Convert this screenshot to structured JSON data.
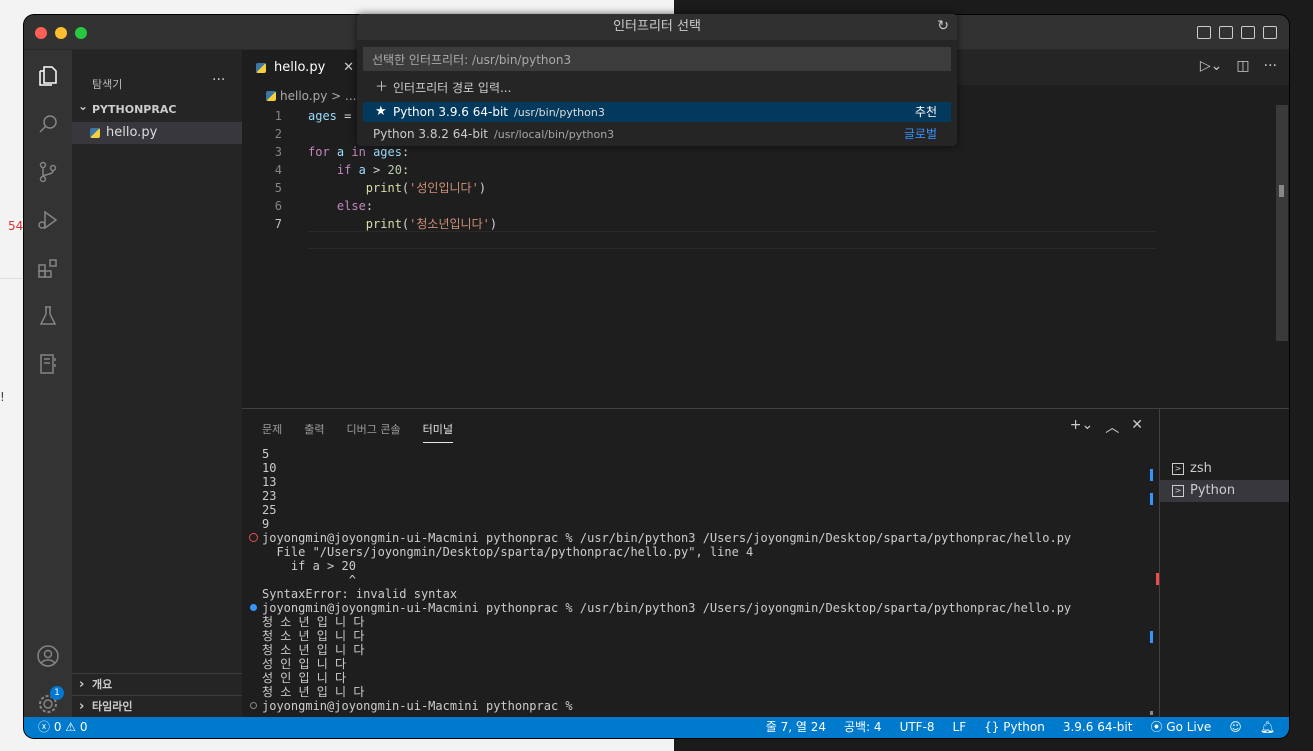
{
  "window": {
    "title": "인터프리터 선택"
  },
  "quick_pick": {
    "title": "인터프리터 선택",
    "input_value": "선택한 인터프리터: /usr/bin/python3",
    "items": [
      {
        "label": "인터프리터 경로 입력...",
        "desc": "",
        "tag": ""
      },
      {
        "label": "Python 3.9.6 64-bit",
        "desc": "/usr/bin/python3",
        "tag": "추천"
      },
      {
        "label": "Python 3.8.2 64-bit",
        "desc": "/usr/local/bin/python3",
        "tag": "글로벌"
      }
    ]
  },
  "sidebar": {
    "title": "탐색기",
    "folder": "PYTHONPRAC",
    "file": "hello.py",
    "sections": [
      "개요",
      "타임라인"
    ]
  },
  "tab": {
    "label": "hello.py"
  },
  "breadcrumb": "hello.py > ...",
  "editor": {
    "lines": [
      {
        "n": "1",
        "code": "ages = "
      },
      {
        "n": "2",
        "code": ""
      },
      {
        "n": "3",
        "code": "for a in ages:"
      },
      {
        "n": "4",
        "code": "    if a > 20:"
      },
      {
        "n": "5",
        "code": "        print('성인입니다')"
      },
      {
        "n": "6",
        "code": "    else:"
      },
      {
        "n": "7",
        "code": "        print('청소년입니다')"
      }
    ]
  },
  "panel": {
    "tabs": [
      "문제",
      "출력",
      "디버그 콘솔",
      "터미널"
    ],
    "active_tab": "터미널",
    "terminal_lines": [
      "5",
      "10",
      "13",
      "23",
      "25",
      "9",
      "joyongmin@joyongmin-ui-Macmini pythonprac % /usr/bin/python3 /Users/joyongmin/Desktop/sparta/pythonprac/hello.py",
      "  File \"/Users/joyongmin/Desktop/sparta/pythonprac/hello.py\", line 4",
      "    if a > 20",
      "            ^",
      "SyntaxError: invalid syntax",
      "joyongmin@joyongmin-ui-Macmini pythonprac % /usr/bin/python3 /Users/joyongmin/Desktop/sparta/pythonprac/hello.py",
      "청 소 년 입 니 다",
      "청 소 년 입 니 다",
      "청 소 년 입 니 다",
      "성 인 입 니 다",
      "성 인 입 니 다",
      "청 소 년 입 니 다",
      "joyongmin@joyongmin-ui-Macmini pythonprac % "
    ],
    "terminals": [
      "zsh",
      "Python"
    ]
  },
  "statusbar": {
    "errors": "0",
    "warnings": "0",
    "position": "줄 7, 열 24",
    "spaces": "공백: 4",
    "encoding": "UTF-8",
    "eol": "LF",
    "language": "Python",
    "interpreter": "3.9.6 64-bit",
    "golive": "Go Live"
  },
  "settings_badge": "1",
  "background": {
    "left_text": "54",
    "excl": "!"
  },
  "colors": {
    "statusbar": "#007acc",
    "selection": "#04395e",
    "accent": "#3794ff"
  }
}
